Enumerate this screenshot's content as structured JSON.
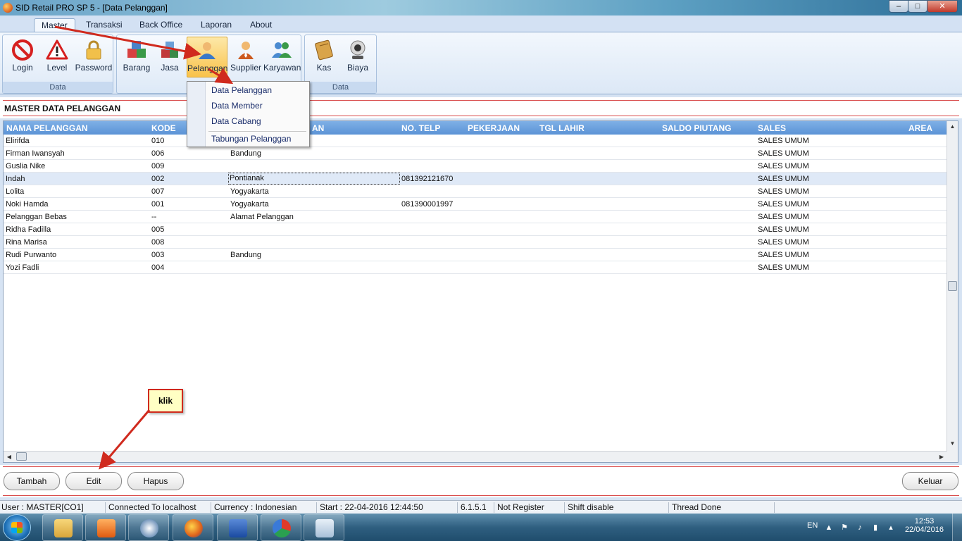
{
  "window": {
    "title": "SID Retail PRO SP 5 - [Data Pelanggan]"
  },
  "tabs": [
    "Master",
    "Transaksi",
    "Back Office",
    "Laporan",
    "About"
  ],
  "ribbon": {
    "group1": {
      "label": "Data",
      "buttons": [
        "Login",
        "Level",
        "Password"
      ]
    },
    "group2": {
      "buttons": [
        "Barang",
        "Jasa",
        "Pelanggan",
        "Supplier",
        "Karyawan"
      ]
    },
    "group3": {
      "label": "Data",
      "buttons": [
        "Kas",
        "Biaya"
      ]
    }
  },
  "menu": {
    "items": [
      "Data Pelanggan",
      "Data Member",
      "Data Cabang",
      "Tabungan Pelanggan"
    ]
  },
  "section": {
    "title": "MASTER DATA PELANGGAN"
  },
  "grid": {
    "columns": [
      "NAMA PELANGGAN",
      "KODE",
      "AN",
      "NO. TELP",
      "PEKERJAAN",
      "TGL LAHIR",
      "SALDO PIUTANG",
      "SALES",
      "AREA"
    ],
    "rows": [
      {
        "nama": "Elirifda",
        "kode": "010",
        "alamat": "",
        "telp": "",
        "sales": "SALES UMUM"
      },
      {
        "nama": "Firman Iwansyah",
        "kode": "006",
        "alamat": "Bandung",
        "telp": "",
        "sales": "SALES UMUM"
      },
      {
        "nama": "Guslia Nike",
        "kode": "009",
        "alamat": "",
        "telp": "",
        "sales": "SALES UMUM"
      },
      {
        "nama": "Indah",
        "kode": "002",
        "alamat": "Pontianak",
        "telp": "081392121670",
        "sales": "SALES UMUM"
      },
      {
        "nama": "Lolita",
        "kode": "007",
        "alamat": "Yogyakarta",
        "telp": "",
        "sales": "SALES UMUM"
      },
      {
        "nama": "Noki Hamda",
        "kode": "001",
        "alamat": "Yogyakarta",
        "telp": "081390001997",
        "sales": "SALES UMUM"
      },
      {
        "nama": "Pelanggan Bebas",
        "kode": "--",
        "alamat": "Alamat Pelanggan",
        "telp": "",
        "sales": "SALES UMUM"
      },
      {
        "nama": "Ridha Fadilla",
        "kode": "005",
        "alamat": "",
        "telp": "",
        "sales": "SALES UMUM"
      },
      {
        "nama": "Rina Marisa",
        "kode": "008",
        "alamat": "",
        "telp": "",
        "sales": "SALES UMUM"
      },
      {
        "nama": "Rudi Purwanto",
        "kode": "003",
        "alamat": "Bandung",
        "telp": "",
        "sales": "SALES UMUM"
      },
      {
        "nama": "Yozi Fadli",
        "kode": "004",
        "alamat": "",
        "telp": "",
        "sales": "SALES UMUM"
      }
    ]
  },
  "buttons": {
    "tambah": "Tambah",
    "edit": "Edit",
    "hapus": "Hapus",
    "keluar": "Keluar"
  },
  "callout": {
    "text": "klik"
  },
  "status": {
    "user": "User : MASTER[CO1]",
    "connection": "Connected To localhost",
    "currency": "Currency : Indonesian",
    "start": "Start  : 22-04-2016 12:44:50",
    "version": "6.1.5.1",
    "register": "Not Register",
    "shift": "Shift disable",
    "thread": "Thread Done"
  },
  "taskbar": {
    "lang": "EN",
    "time": "12:53",
    "date": "22/04/2016"
  },
  "colors": {
    "accent_red": "#d02a1e",
    "header_blue": "#5b93d6",
    "selection": "#dfe9f7"
  }
}
